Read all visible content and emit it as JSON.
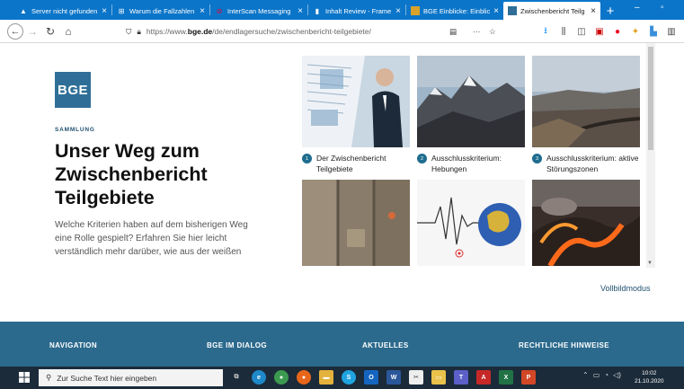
{
  "browser": {
    "tabs": [
      {
        "label": "Server nicht gefunden",
        "icon": "warning-icon"
      },
      {
        "label": "Warum die Fallzahlen",
        "icon": "site-icon"
      },
      {
        "label": "InterScan Messaging",
        "icon": "trend-icon"
      },
      {
        "label": "Inhalt Review - Frame",
        "icon": "doc-icon"
      },
      {
        "label": "BGE Einblicke: Einblic",
        "icon": "bge-icon"
      },
      {
        "label": "Zwischenbericht Teilg",
        "icon": "bge-icon",
        "active": true
      }
    ],
    "new_tab": "+",
    "window_controls": {
      "minimize": "–",
      "maximize": "▫"
    },
    "url_prefix": "https://www.",
    "url_domain": "bge.de",
    "url_path": "/de/endlagersuche/zwischenbericht-teilgebiete/",
    "menu_dots": "···"
  },
  "page": {
    "logo": "BGE",
    "kicker": "SAMMLUNG",
    "headline_lines": [
      "Unser Weg zum",
      "Zwischenbericht",
      "Teilgebiete"
    ],
    "intro": "Welche Kriterien haben auf dem bisherigen Weg eine Rolle gespielt? Erfahren Sie hier leicht verständlich mehr darüber, wie aus der weißen",
    "cards": [
      {
        "num": "1",
        "title": "Der Zwischenbericht Teilgebiete"
      },
      {
        "num": "2",
        "title": "Ausschlusskriterium: Hebungen"
      },
      {
        "num": "3",
        "title": "Ausschlusskriterium: aktive Störungszonen"
      }
    ],
    "fullscreen_link": "Vollbildmodus",
    "footer": [
      "NAVIGATION",
      "BGE IM DIALOG",
      "AKTUELLES",
      "RECHTLICHE HINWEISE"
    ]
  },
  "taskbar": {
    "search_placeholder": "Zur Suche Text hier eingeben",
    "time": "10:02",
    "date": "21.10.2020"
  }
}
